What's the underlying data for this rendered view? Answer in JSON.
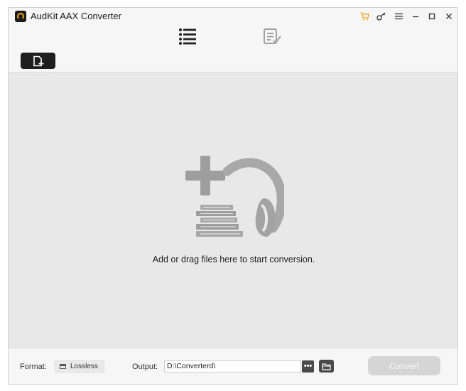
{
  "app": {
    "title": "AudKit AAX Converter"
  },
  "window_controls": [
    "cart-icon",
    "key-icon",
    "menu-icon",
    "minimize-icon",
    "maximize-icon",
    "close-icon"
  ],
  "colors": {
    "accent": "#f0a020",
    "dark": "#1e1e1e",
    "dropzone": "#e8e8e8",
    "convert_disabled": "#d5d5d5"
  },
  "tabs": [
    {
      "icon": "list-icon",
      "active": true
    },
    {
      "icon": "history-icon",
      "active": false
    }
  ],
  "dropzone": {
    "hint": "Add or drag files here to start conversion."
  },
  "footer": {
    "format_label": "Format:",
    "format_value": "Lossless",
    "output_label": "Output:",
    "output_path": "D:\\Converterd\\",
    "more_label": "•••",
    "convert_label": "Convert"
  }
}
